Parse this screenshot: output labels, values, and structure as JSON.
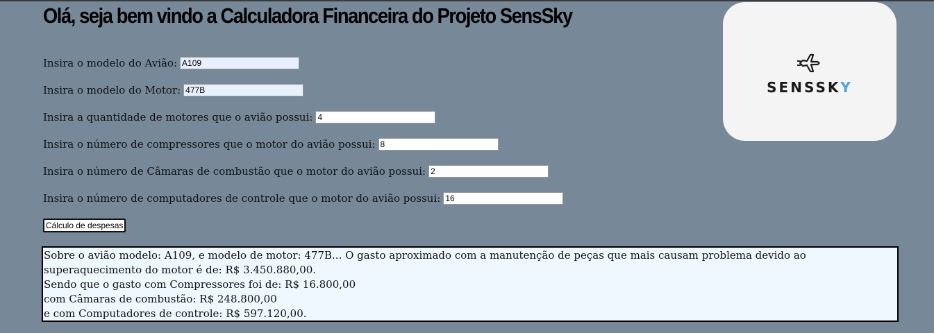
{
  "header": {
    "title": "Olá, seja bem vindo a Calculadora Financeira do Projeto SensSky"
  },
  "logo": {
    "text_main": "SENSSK",
    "text_accent": "Y",
    "icon": "jet-plane-icon",
    "accent_color": "#4da3d9"
  },
  "form": {
    "fields": [
      {
        "label": "Insira o modelo do Avião:",
        "value": "A109"
      },
      {
        "label": "Insira o modelo do Motor:",
        "value": "477B"
      },
      {
        "label": "Insira a quantidade de motores que o avião possui:",
        "value": "4"
      },
      {
        "label": "Insira o número de compressores que o motor do avião possui:",
        "value": "8"
      },
      {
        "label": "Insira o número de Câmaras de combustão que o motor do avião possui:",
        "value": "2"
      },
      {
        "label": "Insira o número de computadores de controle que o motor do avião possui:",
        "value": "16"
      }
    ],
    "submit_label": "Cálculo de despesas"
  },
  "result": {
    "lines": [
      "Sobre o avião modelo: A109, e modelo de motor: 477B... O gasto aproximado com a manutenção de peças que mais causam problema devido ao",
      "superaquecimento do motor é de: R$ 3.450.880,00.",
      "Sendo que o gasto com Compressores foi de: R$ 16.800,00",
      "com Câmaras de combustão: R$ 248.800,00",
      "e com Computadores de controle: R$ 597.120,00."
    ]
  },
  "colors": {
    "page_background": "#778899",
    "result_background": "#f0f8ff",
    "autofill_background": "#e8f0fe"
  }
}
